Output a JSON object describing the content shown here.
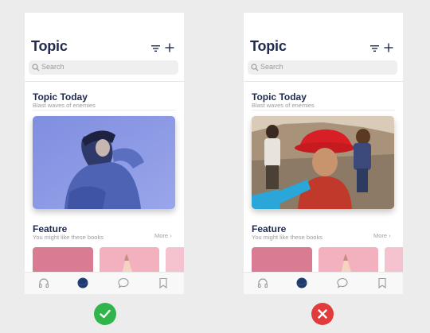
{
  "phones": [
    {
      "variant": "correct",
      "header": {
        "title": "Topic"
      },
      "search": {
        "placeholder": "Search"
      },
      "topic_today": {
        "title": "Topic Today",
        "subtitle": "Blast waves of enemies"
      },
      "feature": {
        "title": "Feature",
        "subtitle": "You might like these books",
        "more": "More"
      },
      "tabbar": {
        "icons": [
          "headphones-icon",
          "planet-icon",
          "chat-icon",
          "bookmark-icon"
        ],
        "active_index": 1
      }
    },
    {
      "variant": "incorrect",
      "header": {
        "title": "Topic"
      },
      "search": {
        "placeholder": "Search"
      },
      "topic_today": {
        "title": "Topic Today",
        "subtitle": "Blast waves of enemies"
      },
      "feature": {
        "title": "Feature",
        "subtitle": "You might like these books",
        "more": "More"
      },
      "tabbar": {
        "icons": [
          "headphones-icon",
          "planet-icon",
          "chat-icon",
          "bookmark-icon"
        ],
        "active_index": 1
      }
    }
  ],
  "verdicts": [
    {
      "variant": "correct",
      "icon": "check-icon",
      "color": "#2fb54a"
    },
    {
      "variant": "incorrect",
      "icon": "cross-icon",
      "color": "#e23b3b"
    }
  ],
  "colors": {
    "title": "#1f2a4d",
    "active_tab": "#1e3a6e",
    "inactive_tab": "#9a9a9a"
  }
}
